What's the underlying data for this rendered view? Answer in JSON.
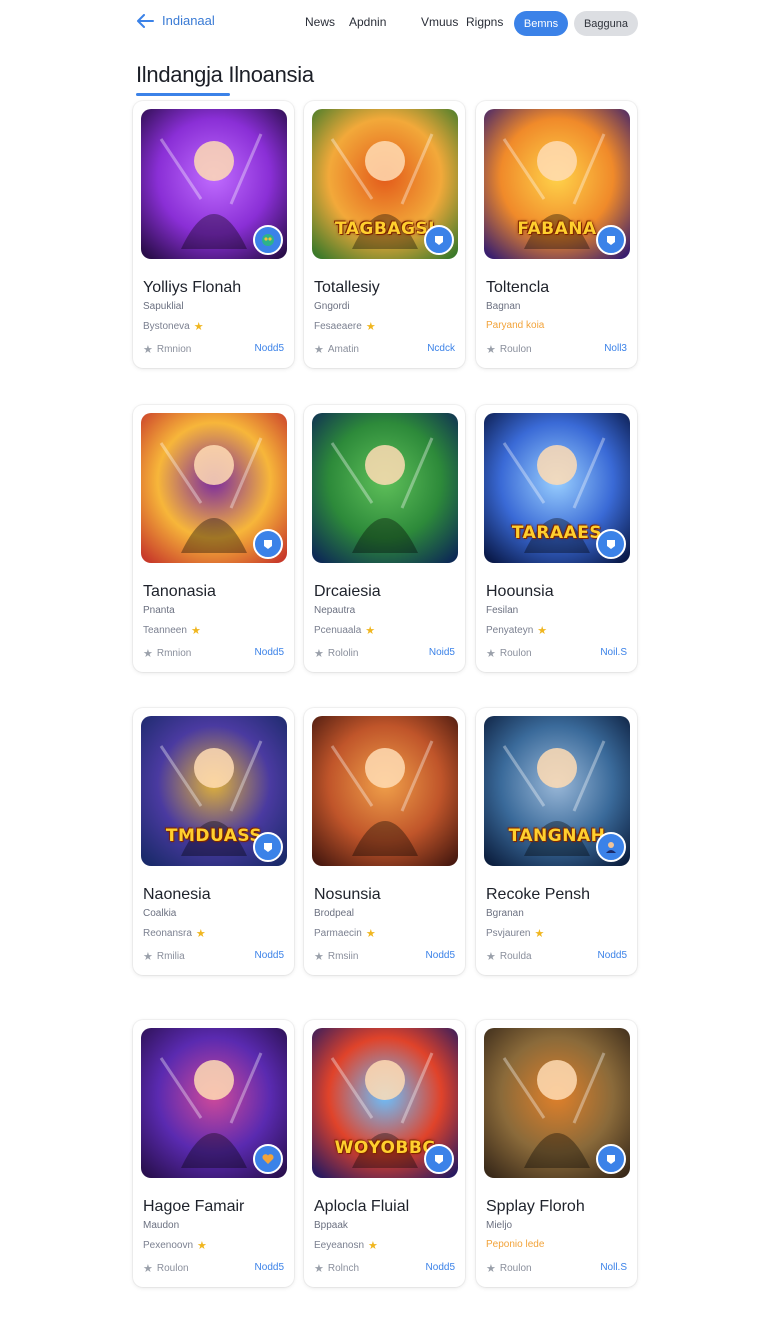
{
  "header": {
    "back_label": "Indianaal",
    "nav": [
      "News",
      "Apdnin",
      "Vmuus",
      "Rigpns"
    ],
    "primary_button": "Bemns",
    "secondary_button": "Bagguna"
  },
  "page": {
    "title": "Ilndangja Ilnoansia"
  },
  "colors": {
    "accent": "#3b82e8",
    "star": "#f0b61f",
    "tag_orange": "#f2a33a"
  },
  "cards": [
    {
      "title": "Yolliys Flonah",
      "subtitle": "Sapuklial",
      "tag": "Bystoneva",
      "tag_icon": "star",
      "tag_style": "gray",
      "stat": "Rmnion",
      "action": "Nodd5",
      "badge_icon": "owl-icon",
      "thumb_text": ""
    },
    {
      "title": "Totallesiy",
      "subtitle": "Gngordi",
      "tag": "Fesaeaere",
      "tag_icon": "star",
      "tag_style": "gray",
      "stat": "Amatin",
      "action": "Ncdck",
      "badge_icon": "pin-icon",
      "thumb_text": "TAGBAGSI"
    },
    {
      "title": "Toltencla",
      "subtitle": "Bagnan",
      "tag": "Paryand koia",
      "tag_icon": "",
      "tag_style": "orange",
      "stat": "Roulon",
      "action": "Noll3",
      "badge_icon": "pin-icon",
      "thumb_text": "FABANA"
    },
    {
      "title": "Tanonasia",
      "subtitle": "Pnanta",
      "tag": "Teanneen",
      "tag_icon": "star",
      "tag_style": "gray",
      "stat": "Rmnion",
      "action": "Nodd5",
      "badge_icon": "pin-icon",
      "thumb_text": ""
    },
    {
      "title": "Drcaiesia",
      "subtitle": "Nepautra",
      "tag": "Pcenuaala",
      "tag_icon": "star",
      "tag_style": "gray",
      "stat": "Rololin",
      "action": "Noid5",
      "badge_icon": "",
      "thumb_text": ""
    },
    {
      "title": "Hoounsia",
      "subtitle": "Fesilan",
      "tag": "Penyateyn",
      "tag_icon": "star",
      "tag_style": "gray",
      "stat": "Roulon",
      "action": "Noil.S",
      "badge_icon": "pin-icon",
      "thumb_text": "TARAAES"
    },
    {
      "title": "Naonesia",
      "subtitle": "Coalkia",
      "tag": "Reonansra",
      "tag_icon": "star",
      "tag_style": "gray",
      "stat": "Rmilia",
      "action": "Nodd5",
      "badge_icon": "pin-icon",
      "thumb_text": "TMDUASS"
    },
    {
      "title": "Nosunsia",
      "subtitle": "Brodpeal",
      "tag": "Parmaecin",
      "tag_icon": "star",
      "tag_style": "gray",
      "stat": "Rmsiin",
      "action": "Nodd5",
      "badge_icon": "",
      "thumb_text": ""
    },
    {
      "title": "Recoke Pensh",
      "subtitle": "Bgranan",
      "tag": "Psvjauren",
      "tag_icon": "star",
      "tag_style": "gray",
      "stat": "Roulda",
      "action": "Nodd5",
      "badge_icon": "avatar-icon",
      "thumb_text": "TANGNAH"
    },
    {
      "title": "Hagoe Famair",
      "subtitle": "Maudon",
      "tag": "Pexenoovn",
      "tag_icon": "star",
      "tag_style": "gray",
      "stat": "Roulon",
      "action": "Nodd5",
      "badge_icon": "heart-icon",
      "thumb_text": ""
    },
    {
      "title": "Aplocla Fluial",
      "subtitle": "Bppaak",
      "tag": "Eeyeanosn",
      "tag_icon": "star",
      "tag_style": "gray",
      "stat": "Rolnch",
      "action": "Nodd5",
      "badge_icon": "pin-icon",
      "thumb_text": "WOYOBBC"
    },
    {
      "title": "Spplay Floroh",
      "subtitle": "Mieljo",
      "tag": "Peponio lede",
      "tag_icon": "",
      "tag_style": "orange",
      "stat": "Roulon",
      "action": "Noll.S",
      "badge_icon": "pin-icon",
      "thumb_text": ""
    }
  ]
}
